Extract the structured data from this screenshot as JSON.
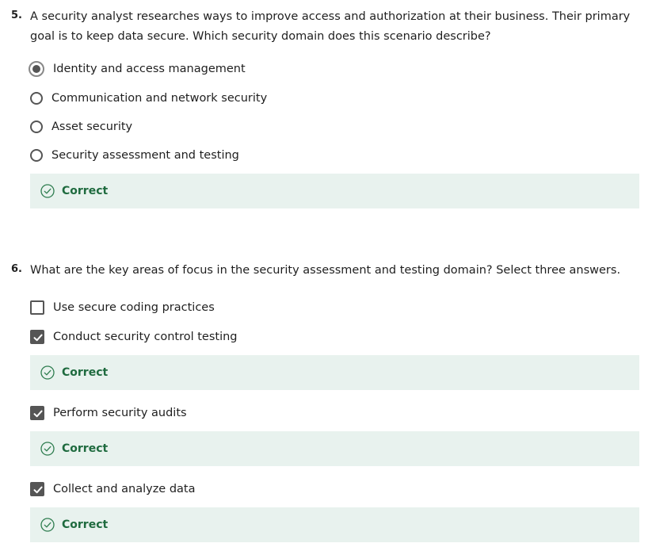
{
  "question5": {
    "number": "5.",
    "text": "A security analyst researches ways to improve access and authorization at their business. Their primary goal is to keep data secure. Which security domain does this scenario describe?",
    "options": [
      {
        "label": "Identity and access management",
        "selected": true
      },
      {
        "label": "Communication and network security",
        "selected": false
      },
      {
        "label": "Asset security",
        "selected": false
      },
      {
        "label": "Security assessment and testing",
        "selected": false
      }
    ],
    "feedback": "Correct"
  },
  "question6": {
    "number": "6.",
    "text": "What are the key areas of focus in the security assessment and testing domain? Select three answers.",
    "options": [
      {
        "label": "Use secure coding practices",
        "checked": false
      },
      {
        "label": "Conduct security control testing",
        "checked": true,
        "feedback": "Correct"
      },
      {
        "label": "Perform security audits",
        "checked": true,
        "feedback": "Correct"
      },
      {
        "label": "Collect and analyze data",
        "checked": true,
        "feedback": "Correct"
      }
    ]
  },
  "colors": {
    "feedback_bg": "#e8f2ee",
    "feedback_text": "#1f6b3f",
    "control": "#555555"
  },
  "icons": {
    "feedback": "check-circle-icon",
    "checkbox_checked": "checkmark-icon"
  }
}
